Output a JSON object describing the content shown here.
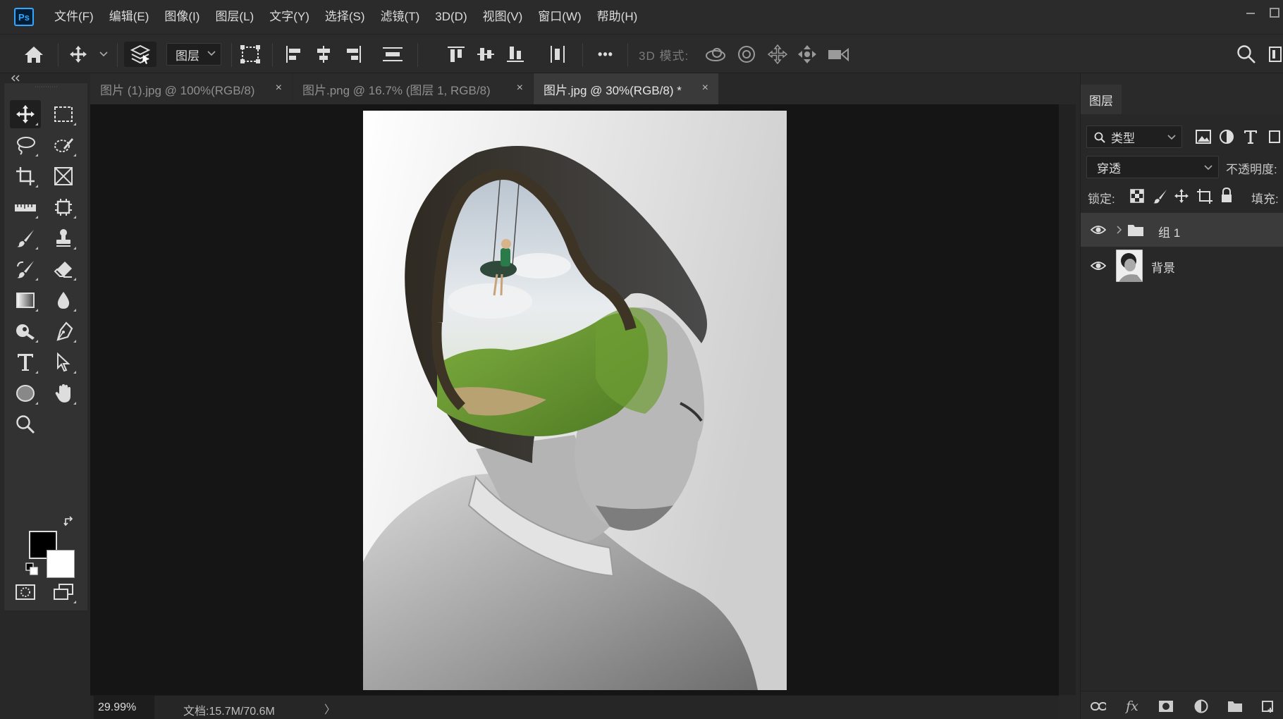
{
  "app": {
    "logo_text": "Ps"
  },
  "menu": [
    "文件(F)",
    "编辑(E)",
    "图像(I)",
    "图层(L)",
    "文字(Y)",
    "选择(S)",
    "滤镜(T)",
    "3D(D)",
    "视图(V)",
    "窗口(W)",
    "帮助(H)"
  ],
  "options": {
    "auto_select_target": "图层",
    "more_label": "•••",
    "mode_3d_label": "3D 模式:"
  },
  "tabs": [
    {
      "label": "图片 (1).jpg @ 100%(RGB/8)",
      "close": "×"
    },
    {
      "label": "图片.png @ 16.7% (图层 1, RGB/8)",
      "close": "×"
    },
    {
      "label": "图片.jpg @ 30%(RGB/8) *",
      "close": "×"
    }
  ],
  "status": {
    "zoom": "29.99%",
    "doc_info": "文档:15.7M/70.6M",
    "arrow": "〉"
  },
  "layers_panel": {
    "tab_label": "图层",
    "kind_filter": "类型",
    "blend_mode": "穿透",
    "opacity_label": "不透明度:",
    "lock_label": "锁定:",
    "fill_label": "填充:",
    "layers": [
      {
        "name": "组 1",
        "type": "group"
      },
      {
        "name": "背景",
        "type": "image"
      }
    ]
  },
  "colors": {
    "accent": "#31a8ff",
    "foreground_color": "#000000",
    "background_color": "#ffffff"
  }
}
